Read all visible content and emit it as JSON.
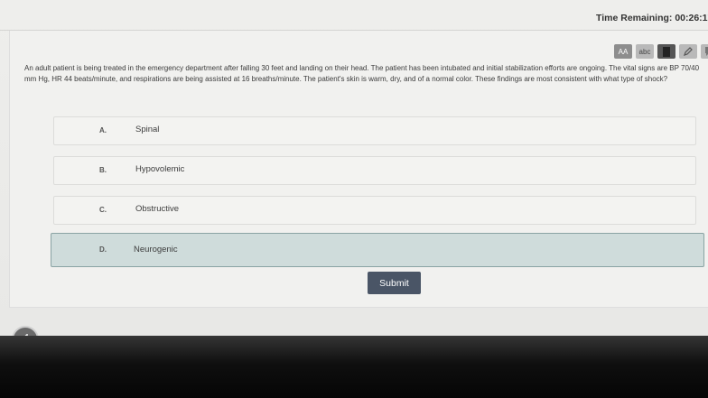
{
  "header": {
    "timer_text": "Time Remaining: 00:26:17"
  },
  "toolbar": {
    "tools": [
      {
        "name": "text-size",
        "label": "AA"
      },
      {
        "name": "strikethrough",
        "label": "abc"
      },
      {
        "name": "bookmark",
        "label": ""
      },
      {
        "name": "highlight",
        "label": ""
      },
      {
        "name": "comment",
        "label": ""
      }
    ]
  },
  "question": {
    "text": "An adult patient is being treated in the emergency department after falling 30 feet and landing on their head. The patient has been intubated and initial stabilization efforts are ongoing. The vital signs are BP 70/40 mm Hg, HR 44 beats/minute, and respirations are being assisted at 16 breaths/minute. The patient's skin is warm, dry, and of a normal color. These findings are most consistent with what type of shock?"
  },
  "choices": [
    {
      "letter": "A.",
      "text": "Spinal",
      "selected": false
    },
    {
      "letter": "B.",
      "text": "Hypovolemic",
      "selected": false
    },
    {
      "letter": "C.",
      "text": "Obstructive",
      "selected": false
    },
    {
      "letter": "D.",
      "text": "Neurogenic",
      "selected": true
    }
  ],
  "submit_label": "Submit",
  "colors": {
    "submit_bg": "#4a5566",
    "selected_bg": "#cfdcdb"
  }
}
